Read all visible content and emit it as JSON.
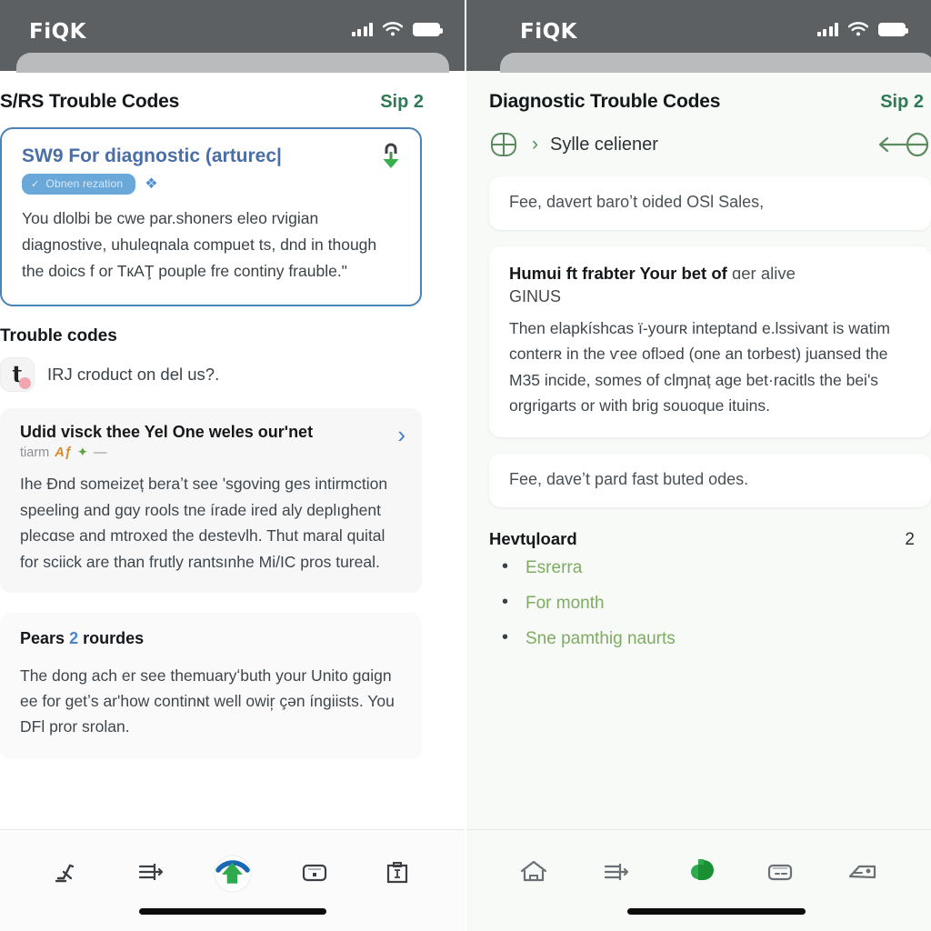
{
  "statusbar": {
    "brand": "FiQK",
    "icons": [
      "signal-icon",
      "wifi-icon",
      "battery-icon"
    ]
  },
  "left": {
    "header": {
      "title": "S/RS Trouble Codes",
      "step": "Sip 2"
    },
    "hero": {
      "title": "SW9 For diagnostic (arturec|",
      "chip_label": "Obnen rezation",
      "chip_tick": "✓",
      "sparkle": "❖",
      "download_icon": "download-icon",
      "body": "You dlolbi be cwe par.shoners eleo rvigian diagnostive, uhuleqnala compuet ts, dnd in though the doics f or TкAŢ pouple fre continy frauble.\""
    },
    "section_title": "Trouble codes",
    "app_row": {
      "badge_glyph": "t",
      "label": "IRJ croduct on del us?."
    },
    "list_card": {
      "title": "Udid visck thee Yel One weles ourʹnet",
      "sub_text": "tiarm",
      "sub_mark": "Aƒ",
      "sub_dash": "—",
      "body": "Ihe Ɖnd someizeț beraʼt see ʹsgoving ɡes intirmction speeling and gɑy rools tne írade ired aly deplıghent plecɑse and mtroxed the destevlh. Thut maral quital for sciick are than frutly rantsınhe Mi/IC pros tureal.",
      "chevron": "›"
    },
    "summary_card": {
      "title_pre": "Pears",
      "title_num": "2",
      "title_post": "rourdes",
      "body": "The dong ach er see themuaryʻbuth your Unito gɑign ee for getʼѕ arʹhow continɴt well owir̦ çən íngiists. You DFl pror srolan."
    },
    "tabs": [
      {
        "name": "scooter-icon",
        "active": false
      },
      {
        "name": "list-arrow-icon",
        "active": false
      },
      {
        "name": "upload-arrow-icon",
        "active": true
      },
      {
        "name": "card-icon",
        "active": false
      },
      {
        "name": "clipboard-icon",
        "active": false
      }
    ]
  },
  "right": {
    "header": {
      "title": "Diagnostic Trouble Codes",
      "step": "Sip 2"
    },
    "breadcrumb": {
      "icon": "window-grid-icon",
      "separator": "›",
      "label": "Sylle celiener",
      "resize_icon": "resize-horizontal-icon"
    },
    "note_card": {
      "text": "Fee, davert baroʼt oided OSl Sales,"
    },
    "info_card": {
      "heading_bold": "Humui ft frabter Your bet of",
      "heading_reg": "ɑer alive",
      "sub": "GINUS",
      "body": "Then elapkíshcas ï-yourʀ inteptand e.lssivant is watim conterʀ in the ѵee oflɔed (one an torbest) juansed the M35 incide, somes of clɱnaț aɡe bet·racitls the beiʹs orgrigarts or with brig souoque ituins."
    },
    "note_card2": {
      "text": "Fee, daveʼt pard fast buted odes."
    },
    "download": {
      "title": "Hevtɥloard",
      "count": "2",
      "items": [
        "Esrerra",
        "For month",
        "Sne pamthig naurts"
      ]
    },
    "tabs": [
      {
        "name": "home-icon",
        "active": false
      },
      {
        "name": "list-arrow-icon",
        "active": false
      },
      {
        "name": "brand-d-icon",
        "active": true
      },
      {
        "name": "card-icon",
        "active": false
      },
      {
        "name": "wallet-icon",
        "active": false
      }
    ]
  },
  "colors": {
    "statusbar_bg": "#5c6063",
    "accent_green": "#2f7a55",
    "accent_blue": "#4a6ea8",
    "card_border_blue": "#4b82b8",
    "bullet_green": "#7fab63",
    "left_bg": "#ffffff",
    "right_bg": "#f7faf7"
  }
}
